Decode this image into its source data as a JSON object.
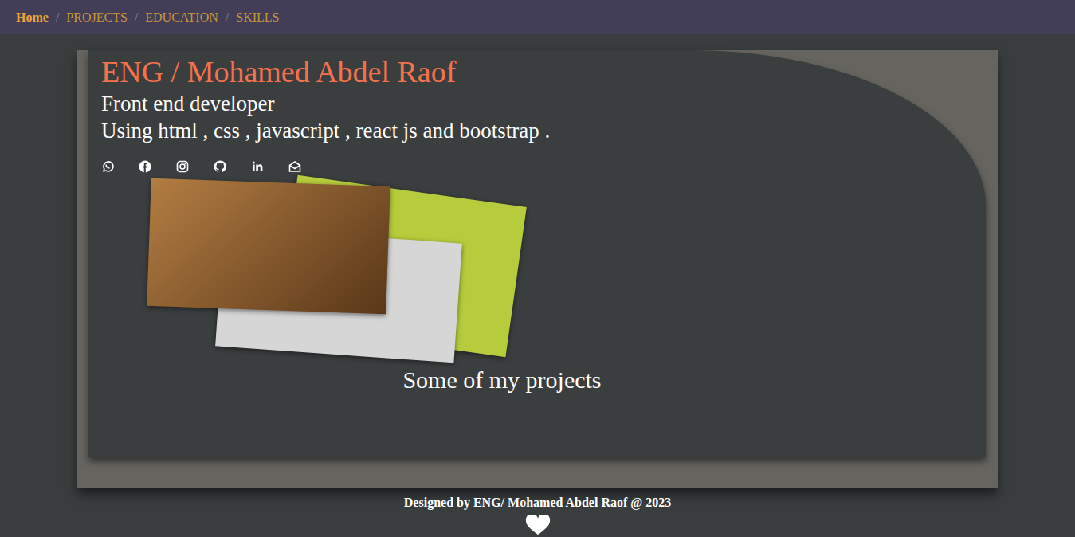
{
  "breadcrumb": {
    "separator": "/",
    "items": [
      {
        "label": "Home",
        "selected": true
      },
      {
        "label": "PROJECTS",
        "selected": false
      },
      {
        "label": "EDUCATION",
        "selected": false
      },
      {
        "label": "SKILLS",
        "selected": false
      }
    ]
  },
  "hero": {
    "title": "ENG / Mohamed Abdel Raof",
    "subtitle": "Front end developer",
    "skills": "Using html , css , javascript , react js and bootstrap ."
  },
  "projects": {
    "caption": "Some of my projects",
    "previews": [
      {
        "color": "#b6cc3c"
      },
      {
        "color": "#d6d6d6"
      },
      {
        "color": "#8a5526"
      }
    ]
  },
  "footer": {
    "text": "Designed by ENG/ Mohamed Abdel Raof @ 2023"
  }
}
